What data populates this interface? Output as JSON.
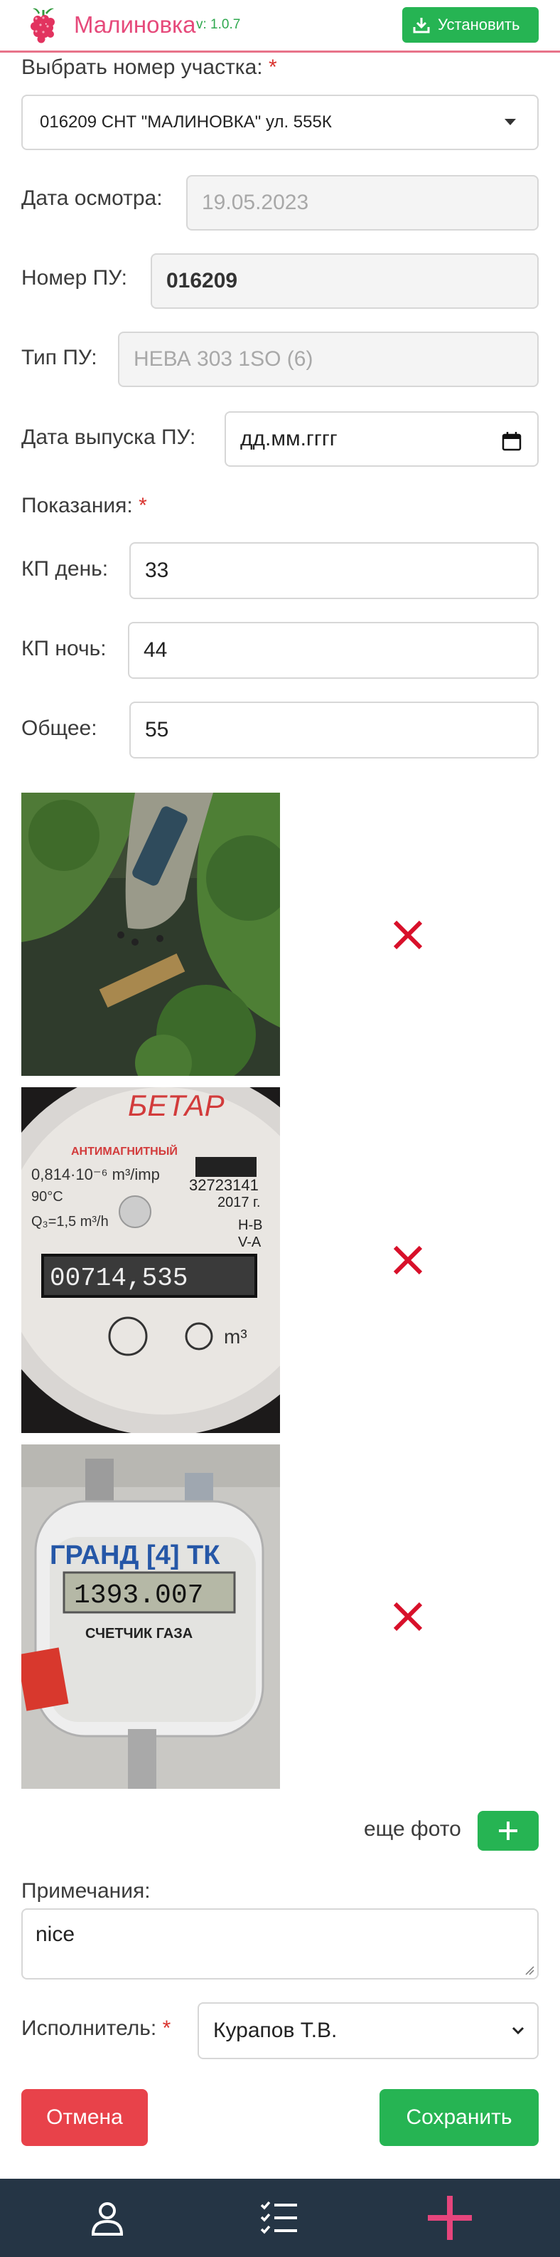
{
  "header": {
    "title": "Малиновка",
    "version": "v: 1.0.7",
    "install_label": "Установить"
  },
  "form": {
    "plot_label": "Выбрать номер участка:",
    "plot_value": "016209 СНТ \"МАЛИНОВКА\" ул. 555К",
    "inspection_date_label": "Дата осмотра:",
    "inspection_date_value": "19.05.2023",
    "meter_number_label": "Номер ПУ:",
    "meter_number_value": "016209",
    "meter_type_label": "Тип ПУ:",
    "meter_type_value": "НЕВА 303 1SO (6)",
    "meter_release_label": "Дата выпуска ПУ:",
    "meter_release_placeholder": "дд.мм.гггг",
    "readings_label": "Показания:",
    "day_label": "КП день:",
    "day_value": "33",
    "night_label": "КП ночь:",
    "night_value": "44",
    "total_label": "Общее:",
    "total_value": "55",
    "more_photo_label": "еще фото",
    "notes_label": "Примечания:",
    "notes_value": "nice",
    "executor_label": "Исполнитель:",
    "executor_value": "Курапов Т.В.",
    "required_mark": "*"
  },
  "photos": [
    {
      "subject": "aerial-river-photo"
    },
    {
      "subject": "water-meter-photo",
      "brand_text": "БЕТАР",
      "serial": "32723141",
      "year": "2017 г.",
      "reading": "00714,535"
    },
    {
      "subject": "gas-meter-photo",
      "brand_text": "ГРАНД [4] ТК",
      "reading": "1393.007",
      "caption": "СЧЕТЧИК ГАЗА"
    }
  ],
  "actions": {
    "cancel_label": "Отмена",
    "save_label": "Сохранить"
  },
  "nav": {
    "items": [
      "user-icon",
      "checklist-icon",
      "plus-icon"
    ]
  },
  "colors": {
    "brand": "#e64a7b",
    "green": "#26b453",
    "red": "#e8424a",
    "nav_bg": "#253545",
    "accent_pink": "#e6457c"
  }
}
